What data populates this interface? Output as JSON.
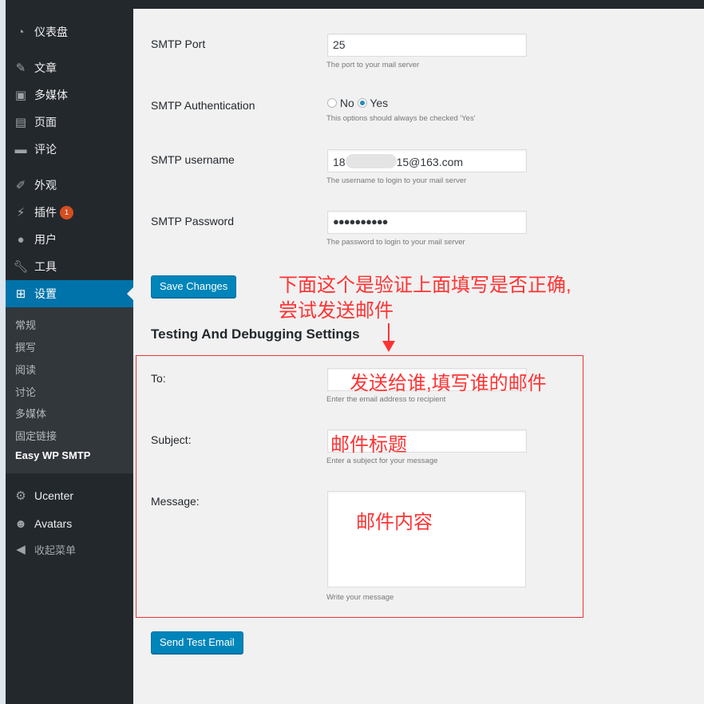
{
  "sidebar": {
    "items": [
      {
        "label": "仪表盘",
        "icon": "dashboard-icon"
      },
      {
        "label": "文章",
        "icon": "pin-icon"
      },
      {
        "label": "多媒体",
        "icon": "media-icon"
      },
      {
        "label": "页面",
        "icon": "page-icon"
      },
      {
        "label": "评论",
        "icon": "comment-icon"
      },
      {
        "label": "外观",
        "icon": "brush-icon"
      },
      {
        "label": "插件",
        "icon": "plugin-icon",
        "badge": "1"
      },
      {
        "label": "用户",
        "icon": "user-icon"
      },
      {
        "label": "工具",
        "icon": "wrench-icon"
      },
      {
        "label": "设置",
        "icon": "settings-icon"
      }
    ],
    "submenu": [
      "常规",
      "撰写",
      "阅读",
      "讨论",
      "多媒体",
      "固定链接",
      "Easy WP SMTP"
    ],
    "extra": [
      {
        "label": "Ucenter",
        "icon": "gear-icon"
      },
      {
        "label": "Avatars",
        "icon": "avatar-icon"
      },
      {
        "label": "收起菜单",
        "icon": "collapse-icon"
      }
    ]
  },
  "form": {
    "port_label": "SMTP Port",
    "port_value": "25",
    "port_desc": "The port to your mail server",
    "auth_label": "SMTP Authentication",
    "auth_no": "No",
    "auth_yes": "Yes",
    "auth_selected": "Yes",
    "auth_desc": "This options should always be checked 'Yes'",
    "user_label": "SMTP username",
    "user_prefix": "18",
    "user_suffix": "15@163.com",
    "user_desc": "The username to login to your mail server",
    "pass_label": "SMTP Password",
    "pass_value": "●●●●●●●●●●",
    "pass_desc": "The password to login to your mail server",
    "save_label": "Save Changes"
  },
  "testing": {
    "heading": "Testing And Debugging Settings",
    "to_label": "To:",
    "to_desc": "Enter the email address to recipient",
    "subject_label": "Subject:",
    "subject_desc": "Enter a subject for your message",
    "message_label": "Message:",
    "message_desc": "Write your message",
    "send_label": "Send Test Email"
  },
  "annotations": {
    "top_line1": "下面这个是验证上面填写是否正确,",
    "top_line2": "尝试发送邮件",
    "to": "发送给谁,填写谁的邮件",
    "subject": "邮件标题",
    "message": "邮件内容",
    "color": "#ff3333"
  }
}
